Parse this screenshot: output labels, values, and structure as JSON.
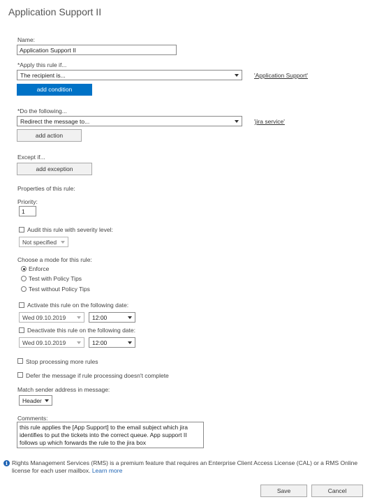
{
  "page": {
    "title": "Application Support II"
  },
  "name_field": {
    "label": "Name:",
    "value": "Application Support II"
  },
  "apply_rule": {
    "label": "*Apply this rule if...",
    "condition_value": "The recipient is...",
    "condition_link": "'Application Support'",
    "add_button": "add condition"
  },
  "do_following": {
    "label": "*Do the following...",
    "action_value": "Redirect the message to...",
    "action_link": "'jira service'",
    "add_button": "add action"
  },
  "except": {
    "label": "Except if...",
    "add_button": "add exception"
  },
  "properties": {
    "heading": "Properties of this rule:",
    "priority_label": "Priority:",
    "priority_value": "1",
    "audit_label": "Audit this rule with severity level:",
    "audit_checked": false,
    "severity_value": "Not specified"
  },
  "mode": {
    "label": "Choose a mode for this rule:",
    "options": [
      "Enforce",
      "Test with Policy Tips",
      "Test without Policy Tips"
    ],
    "selected": "Enforce"
  },
  "activate": {
    "label": "Activate this rule on the following date:",
    "checked": false,
    "date": "Wed 09.10.2019",
    "time": "12:00"
  },
  "deactivate": {
    "label": "Deactivate this rule on the following date:",
    "checked": false,
    "date": "Wed 09.10.2019",
    "time": "12:00"
  },
  "options": {
    "stop_processing": "Stop processing more rules",
    "defer_message": "Defer the message if rule processing doesn't complete",
    "match_sender_label": "Match sender address in message:",
    "match_sender_value": "Header"
  },
  "comments": {
    "label": "Comments:",
    "value": "this rule applies the [App Support] to the email subject which jira identifies to put the tickets into the correct queue. App support II follows up which forwards the rule to the jira box"
  },
  "rms_note": {
    "text": "Rights Management Services (RMS) is a premium feature that requires an Enterprise Client Access License (CAL) or a RMS Online license for each user mailbox.",
    "link": "Learn more"
  },
  "footer": {
    "save": "Save",
    "cancel": "Cancel"
  },
  "icons": {
    "info": "info-icon",
    "dropdown": "chevron-down-icon"
  },
  "colors": {
    "primary_button": "#0072c6",
    "info": "#1f64b4"
  }
}
